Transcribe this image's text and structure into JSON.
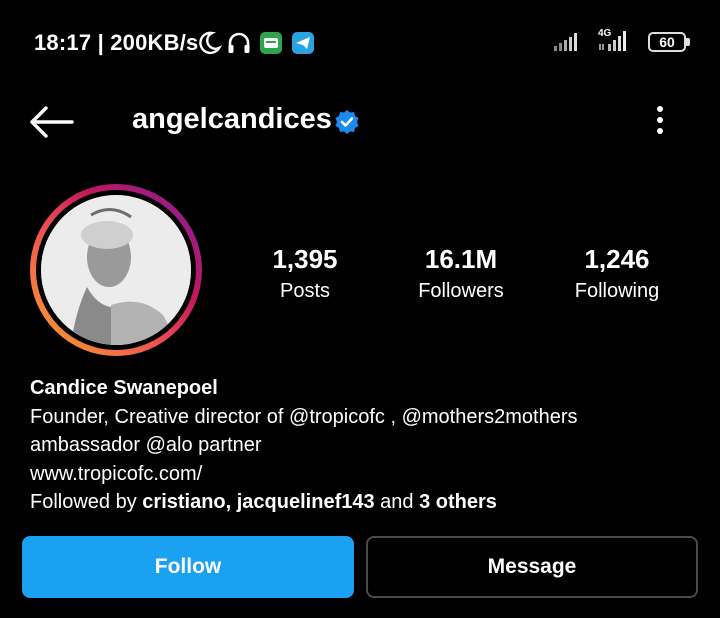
{
  "status_bar": {
    "time_speed": "18:17 | 200KB/s",
    "network": "4G",
    "battery": "60",
    "icons": [
      "moon-icon",
      "headset-icon",
      "app-icon",
      "telegram-icon",
      "signal-icon",
      "signal-4g-icon",
      "battery-icon"
    ]
  },
  "header": {
    "username": "angelcandices",
    "icons": [
      "back-arrow-icon",
      "verified-badge-icon",
      "more-options-icon"
    ]
  },
  "profile": {
    "stats": [
      {
        "value": "1,395",
        "label": "Posts"
      },
      {
        "value": "16.1M",
        "label": "Followers"
      },
      {
        "value": "1,246",
        "label": "Following"
      }
    ],
    "name": "Candice Swanepoel",
    "bio_line1": "Founder, Creative director of @tropicofc , @mothers2mothers",
    "bio_line2": "ambassador @alo partner",
    "link": "www.tropicofc.com/",
    "followed_by_prefix": "Followed by",
    "followed_by_names": "cristiano, jacquelinef143",
    "followed_by_and": "and",
    "followed_by_others": "3 others"
  },
  "actions": {
    "follow_label": "Follow",
    "message_label": "Message"
  },
  "colors": {
    "background": "#000000",
    "follow_button": "#1aa1f2",
    "verified_badge": "#1a8cf0",
    "message_border": "#4a4a4a"
  }
}
